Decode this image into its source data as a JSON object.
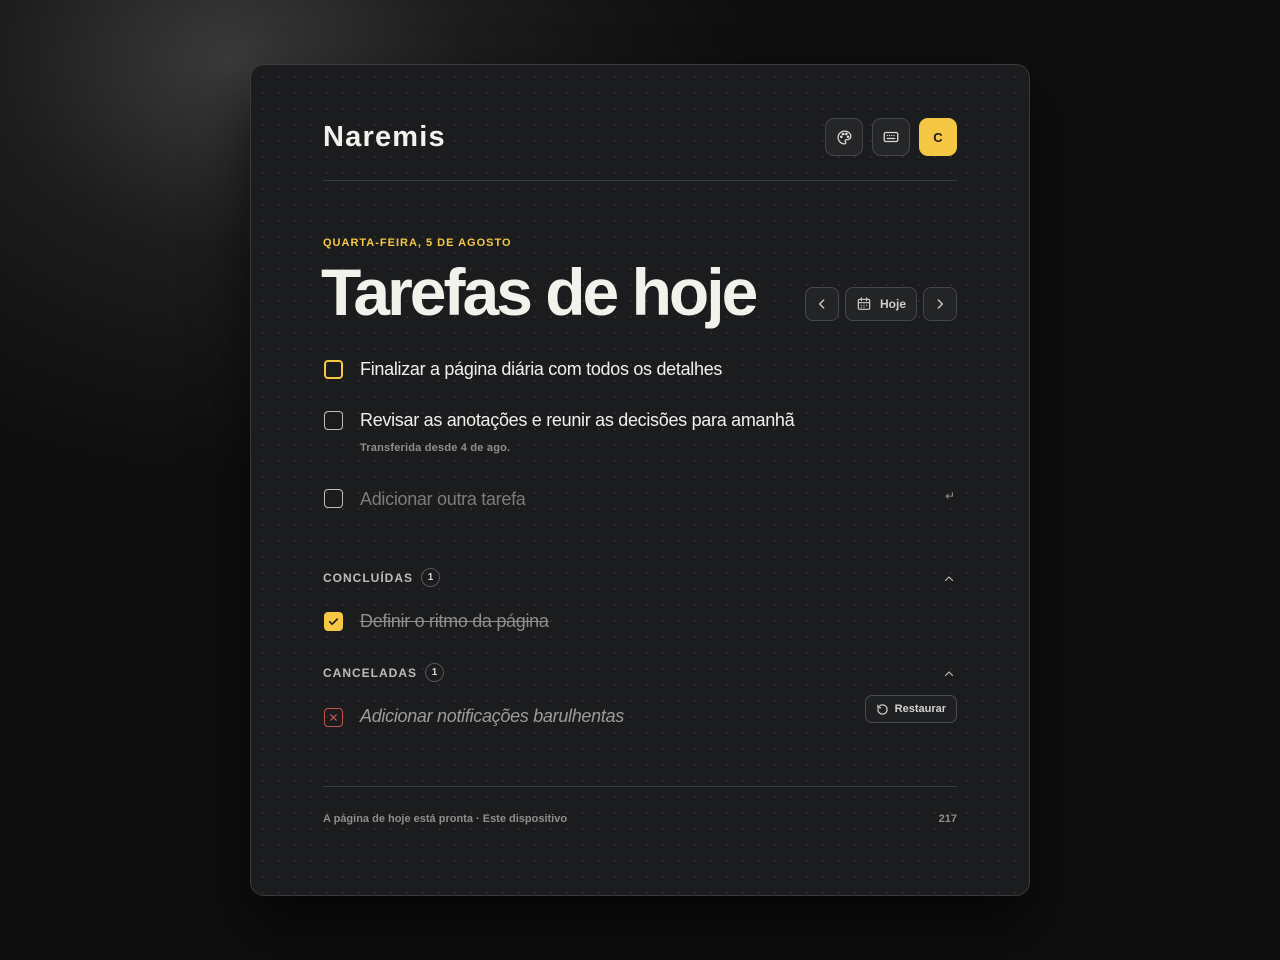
{
  "app": {
    "title": "Naremis",
    "avatar_initial": "C"
  },
  "header": {
    "buttons": [
      {
        "name": "theme-button",
        "icon": "palette-icon"
      },
      {
        "name": "shortcuts-button",
        "icon": "keyboard-icon"
      }
    ]
  },
  "page": {
    "date": "QUARTA-FEIRA, 5 DE AGOSTO",
    "title": "Tarefas de hoje"
  },
  "nav": {
    "today_label": "Hoje",
    "prev_icon": "chevron-left-icon",
    "next_icon": "chevron-right-icon",
    "calendar_icon": "calendar-icon"
  },
  "tasks": [
    {
      "text": "Finalizar a página diária com todos os detalhes",
      "state": "active"
    },
    {
      "text": "Revisar as anotações e reunir as decisões para amanhã",
      "note": "Transferida desde 4 de ago."
    }
  ],
  "add_task": {
    "placeholder": "Adicionar outra tarefa",
    "enter_hint": "↵"
  },
  "completed": {
    "label": "CONCLUÍDAS",
    "count": "1",
    "items": [
      {
        "text": "Definir o ritmo da página"
      }
    ]
  },
  "cancelled": {
    "label": "CANCELADAS",
    "count": "1",
    "items": [
      {
        "text": "Adicionar notificações barulhentas",
        "restore_label": "Restaurar"
      }
    ]
  },
  "footer": {
    "status": "A página de hoje está pronta · Este dispositivo",
    "count": "217"
  },
  "colors": {
    "accent": "#f6c744",
    "cancel": "#c2544f",
    "background": "#1b1c1d"
  }
}
